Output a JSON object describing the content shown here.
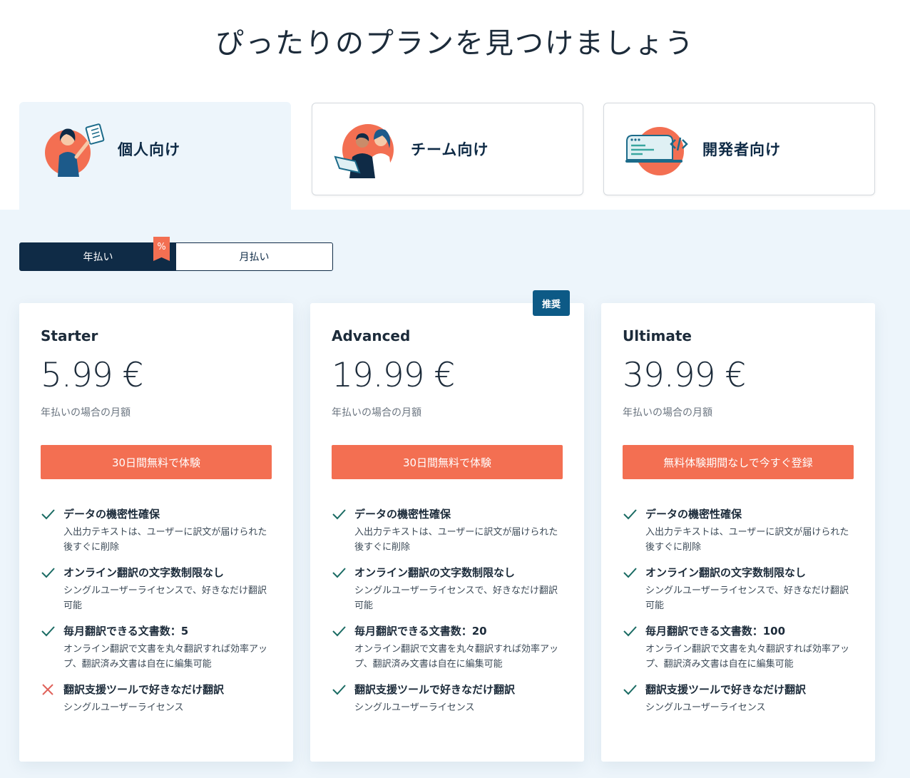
{
  "page": {
    "title": "ぴったりのプランを見つけましょう"
  },
  "audience_tabs": [
    {
      "label": "個人向け",
      "icon": "individual-illustration-icon",
      "active": true
    },
    {
      "label": "チーム向け",
      "icon": "team-illustration-icon",
      "active": false
    },
    {
      "label": "開発者向け",
      "icon": "developer-illustration-icon",
      "active": false
    }
  ],
  "billing": {
    "yearly_label": "年払い",
    "monthly_label": "月払い",
    "discount_badge": "%",
    "selected": "yearly"
  },
  "colors": {
    "accent": "#f36f52",
    "navy": "#0f2b46",
    "badge_blue": "#0d5a86",
    "check": "#1a6b63",
    "cross": "#e0625a",
    "panel_bg": "#edf5fb"
  },
  "plans": [
    {
      "name": "Starter",
      "price": "5.99 €",
      "price_note": "年払いの場合の月額",
      "cta": "30日間無料で体験",
      "recommended": false,
      "features": [
        {
          "title": "データの機密性確保",
          "desc": "入出力テキストは、ユーザーに訳文が届けられた後すぐに削除",
          "included": true
        },
        {
          "title": "オンライン翻訳の文字数制限なし",
          "desc": "シングルユーザーライセンスで、好きなだけ翻訳可能",
          "included": true
        },
        {
          "title": "毎月翻訳できる文書数：5",
          "desc": "オンライン翻訳で文書を丸々翻訳すれば効率アップ、翻訳済み文書は自在に編集可能",
          "included": true
        },
        {
          "title": "翻訳支援ツールで好きなだけ翻訳",
          "desc": "シングルユーザーライセンス",
          "included": false
        }
      ]
    },
    {
      "name": "Advanced",
      "price": "19.99 €",
      "price_note": "年払いの場合の月額",
      "cta": "30日間無料で体験",
      "recommended": true,
      "badge": "推奨",
      "features": [
        {
          "title": "データの機密性確保",
          "desc": "入出力テキストは、ユーザーに訳文が届けられた後すぐに削除",
          "included": true
        },
        {
          "title": "オンライン翻訳の文字数制限なし",
          "desc": "シングルユーザーライセンスで、好きなだけ翻訳可能",
          "included": true
        },
        {
          "title": "毎月翻訳できる文書数：20",
          "desc": "オンライン翻訳で文書を丸々翻訳すれば効率アップ、翻訳済み文書は自在に編集可能",
          "included": true
        },
        {
          "title": "翻訳支援ツールで好きなだけ翻訳",
          "desc": "シングルユーザーライセンス",
          "included": true
        }
      ]
    },
    {
      "name": "Ultimate",
      "price": "39.99 €",
      "price_note": "年払いの場合の月額",
      "cta": "無料体験期間なしで今すぐ登録",
      "recommended": false,
      "features": [
        {
          "title": "データの機密性確保",
          "desc": "入出力テキストは、ユーザーに訳文が届けられた後すぐに削除",
          "included": true
        },
        {
          "title": "オンライン翻訳の文字数制限なし",
          "desc": "シングルユーザーライセンスで、好きなだけ翻訳可能",
          "included": true
        },
        {
          "title": "毎月翻訳できる文書数：100",
          "desc": "オンライン翻訳で文書を丸々翻訳すれば効率アップ、翻訳済み文書は自在に編集可能",
          "included": true
        },
        {
          "title": "翻訳支援ツールで好きなだけ翻訳",
          "desc": "シングルユーザーライセンス",
          "included": true
        }
      ]
    }
  ]
}
